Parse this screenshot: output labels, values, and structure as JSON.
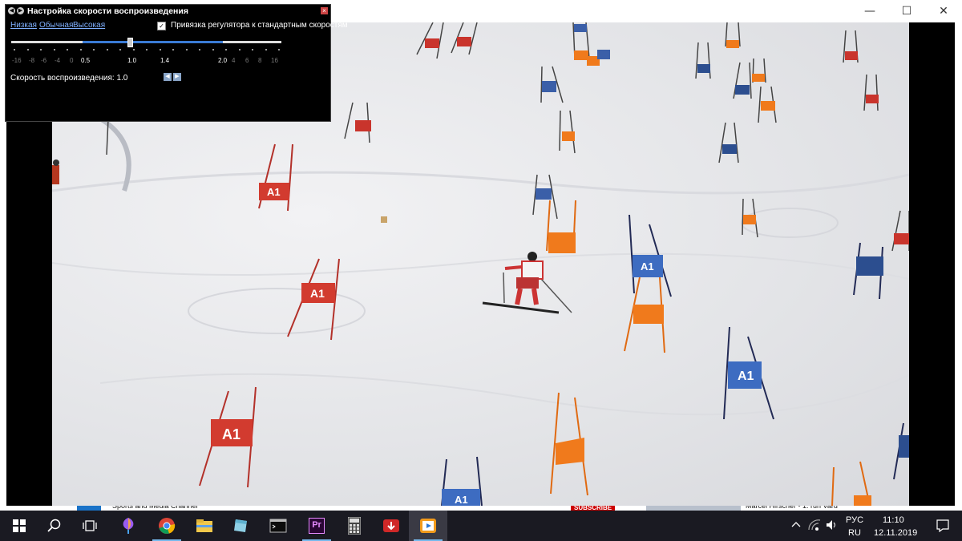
{
  "window": {
    "minimize_glyph": "—",
    "maximize_glyph": "☐",
    "close_glyph": "✕"
  },
  "background_strip": {
    "channel_text": "Sports and Media Channel",
    "subscribe_badge": "SUBSCRIBE",
    "next_video_text": "Marcel Hirscher - 1. run Vard"
  },
  "speed_dialog": {
    "title": "Настройка скорости воспроизведения",
    "presets": [
      "Низкая",
      "Обычная",
      "Высокая"
    ],
    "snap_checkbox_checked": true,
    "snap_label": "Привязка регулятора к стандартным скоростям",
    "slider_value": 1.0,
    "tick_labels": [
      {
        "text": "-16",
        "main": false
      },
      {
        "text": "-8",
        "main": false
      },
      {
        "text": "-6",
        "main": false
      },
      {
        "text": "-4",
        "main": false
      },
      {
        "text": "0",
        "main": false
      },
      {
        "text": "0.5",
        "main": true
      },
      {
        "text": "1.0",
        "main": true
      },
      {
        "text": "1.4",
        "main": true
      },
      {
        "text": "2.0",
        "main": true
      },
      {
        "text": "4",
        "main": false
      },
      {
        "text": "6",
        "main": false
      },
      {
        "text": "8",
        "main": false
      },
      {
        "text": "16",
        "main": false
      }
    ],
    "rate_label": "Скорость воспроизведения: 1.0"
  },
  "taskbar": {
    "items": [
      {
        "name": "start-button",
        "icon": "windows-icon"
      },
      {
        "name": "search-button",
        "icon": "search-icon"
      },
      {
        "name": "task-view-button",
        "icon": "task-view-icon"
      },
      {
        "name": "paint3d-button",
        "icon": "paint-icon"
      },
      {
        "name": "chrome-button",
        "icon": "chrome-icon"
      },
      {
        "name": "file-explorer-button",
        "icon": "folder-icon"
      },
      {
        "name": "notes-app-button",
        "icon": "notes-icon"
      },
      {
        "name": "terminal-button",
        "icon": "terminal-icon"
      },
      {
        "name": "premiere-button",
        "icon": "premiere-icon",
        "label": "Pr"
      },
      {
        "name": "calculator-button",
        "icon": "calculator-icon"
      },
      {
        "name": "downloader-button",
        "icon": "download-icon"
      },
      {
        "name": "media-player-button",
        "icon": "media-player-icon"
      }
    ],
    "language_top": "РУС",
    "language_bottom": "RU",
    "time": "11:10",
    "date": "12.11.2019"
  }
}
